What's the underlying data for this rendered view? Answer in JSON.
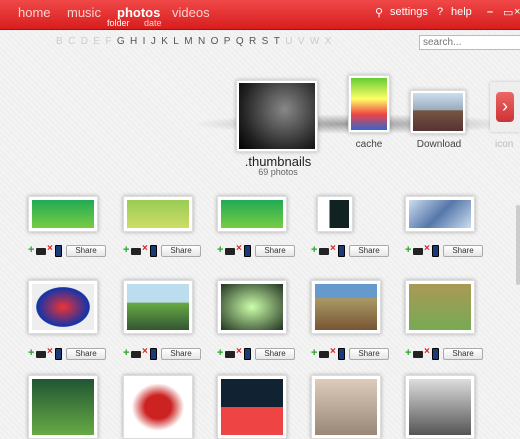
{
  "nav": {
    "home": "home",
    "music": "music",
    "photos": "photos",
    "videos": "videos",
    "sub_folder": "folder",
    "sub_date": "date",
    "settings": "settings",
    "help": "help"
  },
  "alphabet": [
    "B",
    "C",
    "D",
    "E",
    "F",
    "G",
    "H",
    "I",
    "J",
    "K",
    "L",
    "M",
    "N",
    "O",
    "P",
    "Q",
    "R",
    "S",
    "T",
    "U",
    "V",
    "W",
    "X"
  ],
  "alphabet_active": [
    "G",
    "H",
    "I",
    "J",
    "K",
    "L",
    "M",
    "N",
    "O",
    "P",
    "Q",
    "R",
    "S",
    "T"
  ],
  "search": {
    "placeholder": "search..."
  },
  "folders": {
    "main": {
      "name": ".thumbnails",
      "count": "69 photos"
    },
    "cache": "cache",
    "download": "Download",
    "icon": "icon"
  },
  "share_label": "Share",
  "colors": {
    "topbar": "#e02a2a",
    "active": "#ffffff"
  }
}
